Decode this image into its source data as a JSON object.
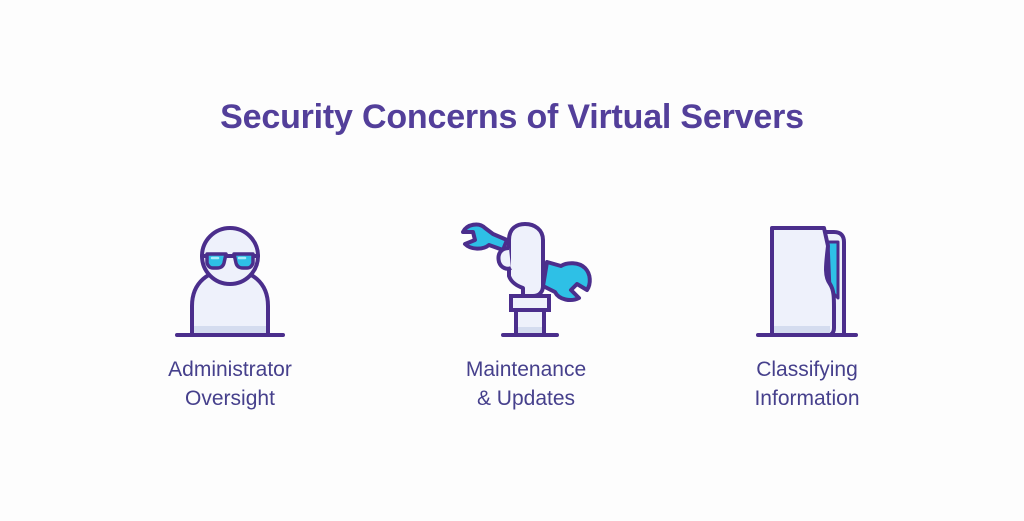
{
  "title": "Security Concerns of Virtual Servers",
  "colors": {
    "title": "#533f9a",
    "label": "#46408c",
    "outline": "#4b2e8c",
    "fill": "#eef1fb",
    "shadow": "#d4dcef",
    "accent": "#2ec0e6",
    "background": "#fdfdfd"
  },
  "items": [
    {
      "icon": "person-with-glasses-icon",
      "line1": "Administrator",
      "line2": "Oversight"
    },
    {
      "icon": "hand-holding-wrench-icon",
      "line1": "Maintenance",
      "line2": "& Updates"
    },
    {
      "icon": "folder-document-icon",
      "line1": "Classifying",
      "line2": "Information"
    }
  ]
}
